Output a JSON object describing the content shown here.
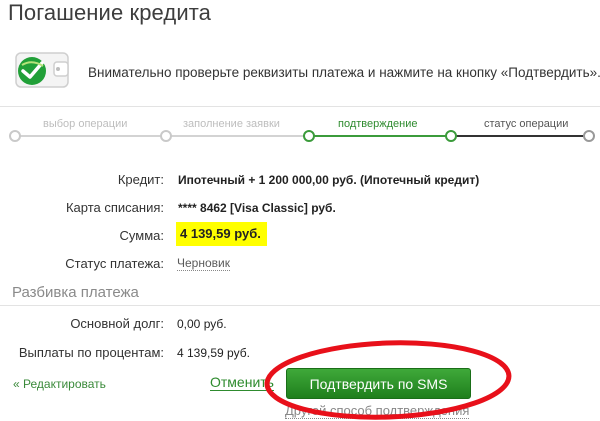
{
  "page": {
    "title": "Погашение кредита"
  },
  "info": {
    "text": "Внимательно проверьте реквизиты платежа и нажмите на кнопку «Подтвердить»."
  },
  "steps": [
    {
      "label": "выбор операции",
      "state": "done"
    },
    {
      "label": "заполнение заявки",
      "state": "done"
    },
    {
      "label": "подтверждение",
      "state": "current"
    },
    {
      "label": "статус операции",
      "state": "pending"
    }
  ],
  "colors": {
    "accent_green": "#2e8b2e",
    "highlight_yellow": "#ffff00",
    "annotation_red": "#e8101a"
  },
  "details": {
    "credit_label": "Кредит:",
    "credit_value": "Ипотечный + 1 200 000,00 руб. (Ипотечный кредит)",
    "card_label": "Карта списания:",
    "card_value": "**** 8462 [Visa Classic] руб.",
    "amount_label": "Сумма:",
    "amount_value": "4 139,59 руб.",
    "status_label": "Статус платежа:",
    "status_value": "Черновик"
  },
  "breakdown": {
    "title": "Разбивка платежа",
    "principal_label": "Основной долг:",
    "principal_value": "0,00 руб.",
    "interest_label": "Выплаты по процентам:",
    "interest_value": "4 139,59 руб."
  },
  "actions": {
    "edit_label": "« Редактировать",
    "cancel_label": "Отменить",
    "confirm_label": "Подтвердить по SMS",
    "other_method_label": "Другой способ подтверждения"
  },
  "icons": {
    "logo": "sberbank-wallet-icon"
  }
}
